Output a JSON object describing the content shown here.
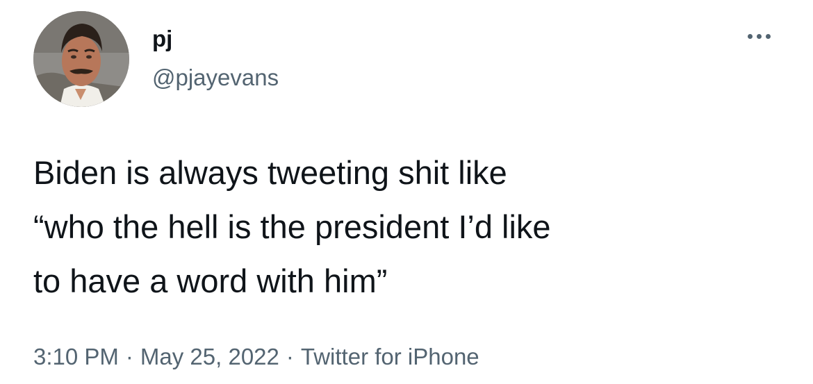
{
  "author": {
    "display_name": "pj",
    "handle": "@pjayevans",
    "avatar_icon": "profile-photo"
  },
  "more_icon": "more-horizontal-icon",
  "tweet": {
    "text": "Biden is always tweeting shit like\n“who the hell is the president I’d like\nto have a word with him”",
    "time": "3:10 PM",
    "date": "May 25, 2022",
    "source": "Twitter for iPhone",
    "separator": "·"
  },
  "colors": {
    "text_primary": "#0f1419",
    "text_secondary": "#536471",
    "background": "#ffffff"
  }
}
